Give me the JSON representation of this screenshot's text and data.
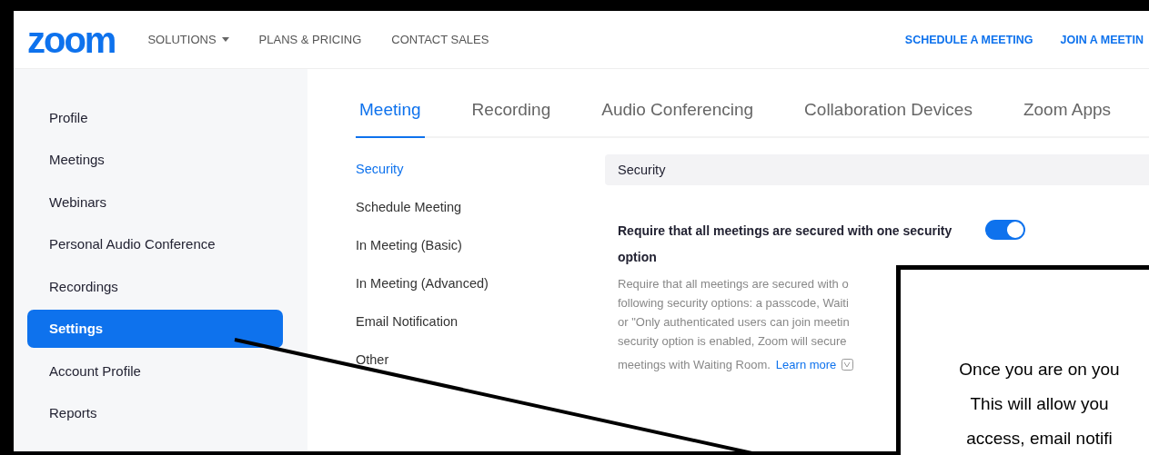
{
  "header": {
    "logo": "zoom",
    "nav": [
      {
        "label": "SOLUTIONS",
        "dropdown": true
      },
      {
        "label": "PLANS & PRICING",
        "dropdown": false
      },
      {
        "label": "CONTACT SALES",
        "dropdown": false
      }
    ],
    "actions": [
      "SCHEDULE A MEETING",
      "JOIN A MEETIN"
    ]
  },
  "sidebar": {
    "items": [
      {
        "label": "Profile",
        "selected": false
      },
      {
        "label": "Meetings",
        "selected": false
      },
      {
        "label": "Webinars",
        "selected": false
      },
      {
        "label": "Personal Audio Conference",
        "selected": false
      },
      {
        "label": "Recordings",
        "selected": false
      },
      {
        "label": "Settings",
        "selected": true
      },
      {
        "label": "Account Profile",
        "selected": false
      },
      {
        "label": "Reports",
        "selected": false
      }
    ]
  },
  "tabs": [
    {
      "label": "Meeting",
      "selected": true
    },
    {
      "label": "Recording",
      "selected": false
    },
    {
      "label": "Audio Conferencing",
      "selected": false
    },
    {
      "label": "Collaboration Devices",
      "selected": false
    },
    {
      "label": "Zoom Apps",
      "selected": false
    }
  ],
  "subnav": [
    {
      "label": "Security",
      "selected": true
    },
    {
      "label": "Schedule Meeting",
      "selected": false
    },
    {
      "label": "In Meeting (Basic)",
      "selected": false
    },
    {
      "label": "In Meeting (Advanced)",
      "selected": false
    },
    {
      "label": "Email Notification",
      "selected": false
    },
    {
      "label": "Other",
      "selected": false
    }
  ],
  "section": {
    "title": "Security",
    "setting": {
      "title": "Require that all meetings are secured with one security option",
      "on": true,
      "description_lines": [
        "Require that all meetings are secured with o",
        "following security options: a passcode, Waiti",
        "or \"Only authenticated users can join meetin",
        "security option is enabled, Zoom will secure",
        "meetings with Waiting Room."
      ],
      "link": "Learn more"
    }
  },
  "callout": {
    "lines": [
      "Once you are on you",
      "This will allow you",
      "access, email notifi"
    ]
  }
}
